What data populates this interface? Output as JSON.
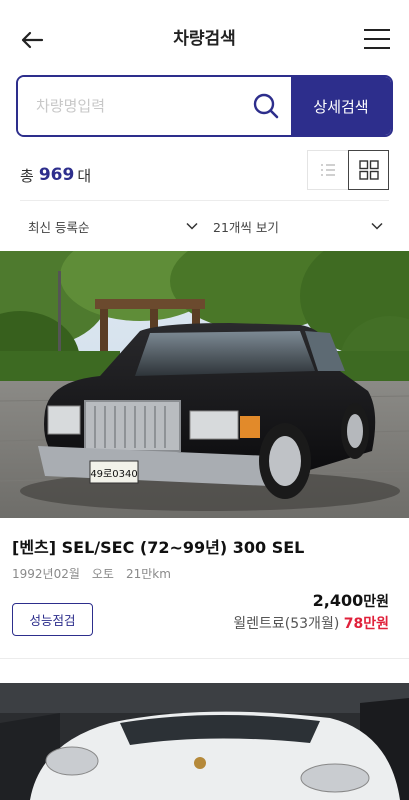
{
  "header": {
    "title": "차량검색",
    "back_icon": "arrow-left-icon",
    "menu_icon": "hamburger-menu-icon"
  },
  "search": {
    "placeholder": "차량명입력",
    "value": "",
    "detail_label": "상세검색",
    "accent": "#2d2e8c"
  },
  "results": {
    "prefix": "총",
    "count": "969",
    "suffix": "대"
  },
  "view": {
    "options": [
      "list",
      "grid"
    ],
    "selected": "grid"
  },
  "sort": {
    "order": "최신 등록순",
    "per_page": "21개씩 보기"
  },
  "listings": [
    {
      "title": "[벤츠] SEL/SEC (72~99년) 300 SEL",
      "year_month": "1992년02월",
      "transmission": "오토",
      "mileage": "21만km",
      "inspect_label": "성능점검",
      "price_value": "2,400",
      "price_unit": "만원",
      "rent_label": "윌렌트료(53개월)",
      "rent_value": "78만원",
      "plate": "49로0340",
      "photo_icon": "black-sedan-photo"
    },
    {
      "photo_icon": "white-suv-photo"
    }
  ],
  "colors": {
    "primary": "#2d2e8c",
    "price_red": "#e0213b",
    "muted": "#8a8a8a"
  }
}
